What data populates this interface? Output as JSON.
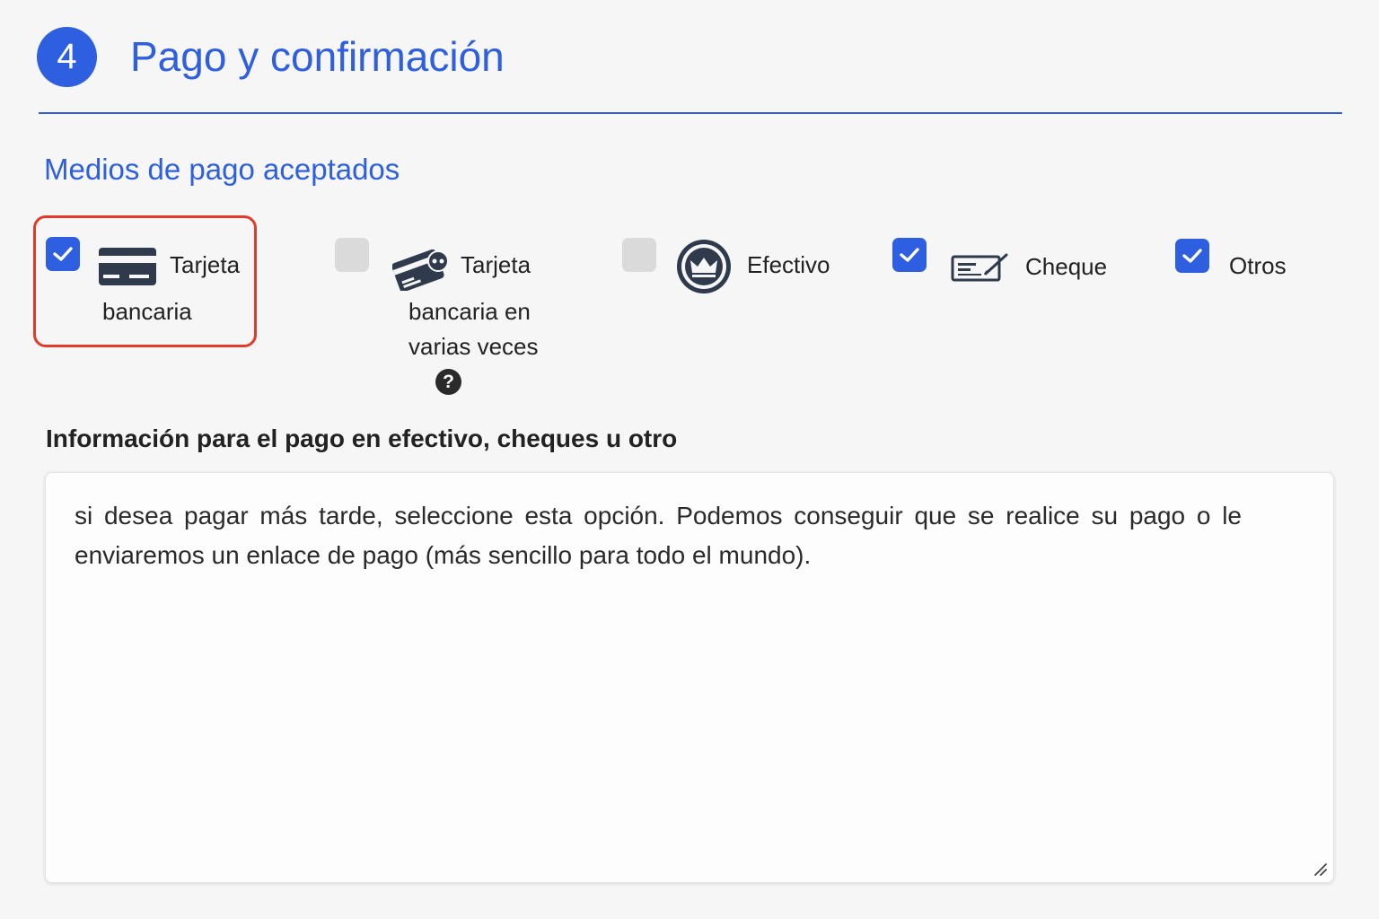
{
  "header": {
    "step_number": "4",
    "title": "Pago y confirmación"
  },
  "payment": {
    "section_title": "Medios de pago aceptados",
    "options": [
      {
        "label_line1": "Tarjeta",
        "label_line2": "bancaria",
        "label_line3": "",
        "checked": true,
        "icon": "credit-card-icon",
        "highlighted": true
      },
      {
        "label_line1": "Tarjeta",
        "label_line2": "bancaria en",
        "label_line3": "varias veces",
        "checked": false,
        "icon": "installment-card-icon",
        "help": "?"
      },
      {
        "label_line1": "Efectivo",
        "checked": false,
        "icon": "cash-crown-icon"
      },
      {
        "label_line1": "Cheque",
        "checked": true,
        "icon": "cheque-icon"
      },
      {
        "label_line1": "Otros",
        "checked": true,
        "icon": ""
      }
    ]
  },
  "info": {
    "label": "Información para el pago en efectivo, cheques u otro",
    "text": "si desea pagar más tarde, seleccione esta opción. Podemos conseguir que se realice su pago o le enviaremos un enlace de pago (más sencillo para todo el mundo)."
  },
  "colors": {
    "accent": "#2e5fe0",
    "highlight_border": "#e23b2c",
    "checkbox_off": "#dadada"
  }
}
